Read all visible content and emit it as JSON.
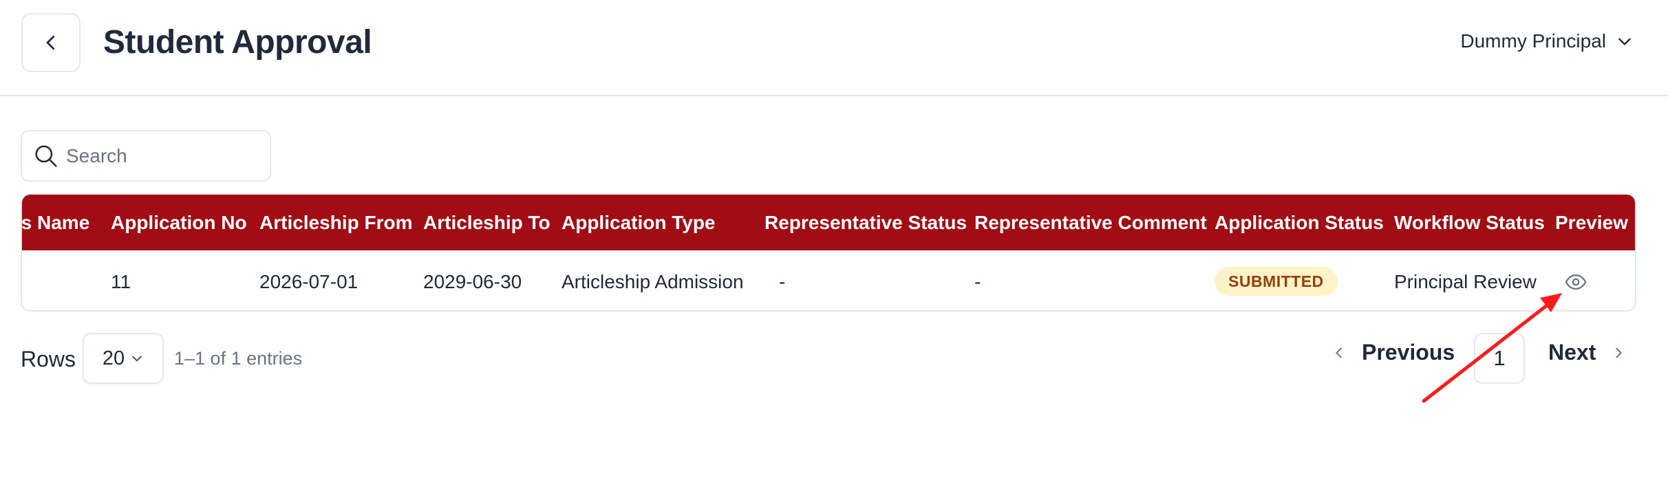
{
  "header": {
    "title": "Student Approval",
    "user_name": "Dummy Principal"
  },
  "search": {
    "placeholder": "Search",
    "value": ""
  },
  "table": {
    "columns": [
      "'s Name",
      "Application No",
      "Articleship From",
      "Articleship To",
      "Application Type",
      "Representative Status",
      "Representative Comment",
      "Application Status",
      "Workflow Status",
      "Preview"
    ],
    "rows": [
      {
        "name": "",
        "application_no": "11",
        "articleship_from": "2026-07-01",
        "articleship_to": "2029-06-30",
        "application_type": "Articleship Admission",
        "representative_status": "-",
        "representative_comment": "-",
        "application_status": "SUBMITTED",
        "workflow_status": "Principal Review",
        "preview_icon": "eye-icon"
      }
    ]
  },
  "pagination": {
    "rows_label": "Rows",
    "rows_per_page": "20",
    "entries_text": "1–1 of 1 entries",
    "previous_label": "Previous",
    "current_page": "1",
    "next_label": "Next"
  },
  "colors": {
    "header_bg": "#a00d14",
    "badge_bg": "#fef3c7",
    "badge_text": "#92400e",
    "annotation_arrow": "#ff1a1a"
  }
}
